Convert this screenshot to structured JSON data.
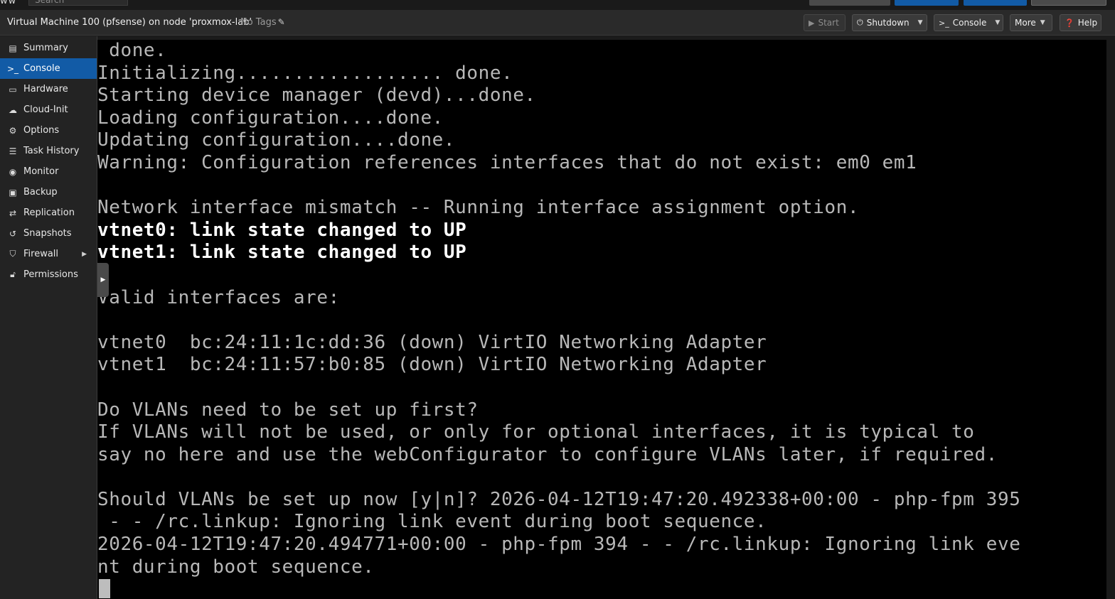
{
  "global": {
    "brand": "ww",
    "search_placeholder": "Search"
  },
  "header": {
    "title": "Virtual Machine 100 (pfsense) on node 'proxmox-lab'",
    "tags_label": "No Tags",
    "buttons": {
      "start": "Start",
      "shutdown": "Shutdown",
      "console": "Console",
      "more": "More",
      "help": "Help"
    }
  },
  "sidebar": {
    "items": [
      {
        "label": "Summary",
        "icon": "book-icon"
      },
      {
        "label": "Console",
        "icon": "terminal-icon",
        "active": true
      },
      {
        "label": "Hardware",
        "icon": "monitor-icon"
      },
      {
        "label": "Cloud-Init",
        "icon": "cloud-icon"
      },
      {
        "label": "Options",
        "icon": "gear-icon"
      },
      {
        "label": "Task History",
        "icon": "list-icon"
      },
      {
        "label": "Monitor",
        "icon": "eye-icon"
      },
      {
        "label": "Backup",
        "icon": "floppy-icon"
      },
      {
        "label": "Replication",
        "icon": "retweet-icon"
      },
      {
        "label": "Snapshots",
        "icon": "history-icon"
      },
      {
        "label": "Firewall",
        "icon": "shield-icon"
      },
      {
        "label": "Permissions",
        "icon": "unlock-icon"
      }
    ]
  },
  "console": {
    "lines": [
      " done.",
      "Initializing.................. done.",
      "Starting device manager (devd)...done.",
      "Loading configuration....done.",
      "Updating configuration....done.",
      "Warning: Configuration references interfaces that do not exist: em0 em1",
      "",
      "Network interface mismatch -- Running interface assignment option.",
      "vtnet0: link state changed to UP",
      "vtnet1: link state changed to UP",
      "",
      "Valid interfaces are:",
      "",
      "vtnet0  bc:24:11:1c:dd:36 (down) VirtIO Networking Adapter",
      "vtnet1  bc:24:11:57:b0:85 (down) VirtIO Networking Adapter",
      "",
      "Do VLANs need to be set up first?",
      "If VLANs will not be used, or only for optional interfaces, it is typical to",
      "say no here and use the webConfigurator to configure VLANs later, if required.",
      "",
      "Should VLANs be set up now [y|n]? 2026-04-12T19:47:20.492338+00:00 - php-fpm 395",
      " - - /rc.linkup: Ignoring link event during boot sequence.",
      "2026-04-12T19:47:20.494771+00:00 - php-fpm 394 - - /rc.linkup: Ignoring link eve",
      "nt during boot sequence."
    ]
  },
  "colors": {
    "accent": "#125ba6",
    "toolbar_bg": "#2a2a2a",
    "sidebar_bg": "#232323",
    "console_bg": "#000000"
  }
}
